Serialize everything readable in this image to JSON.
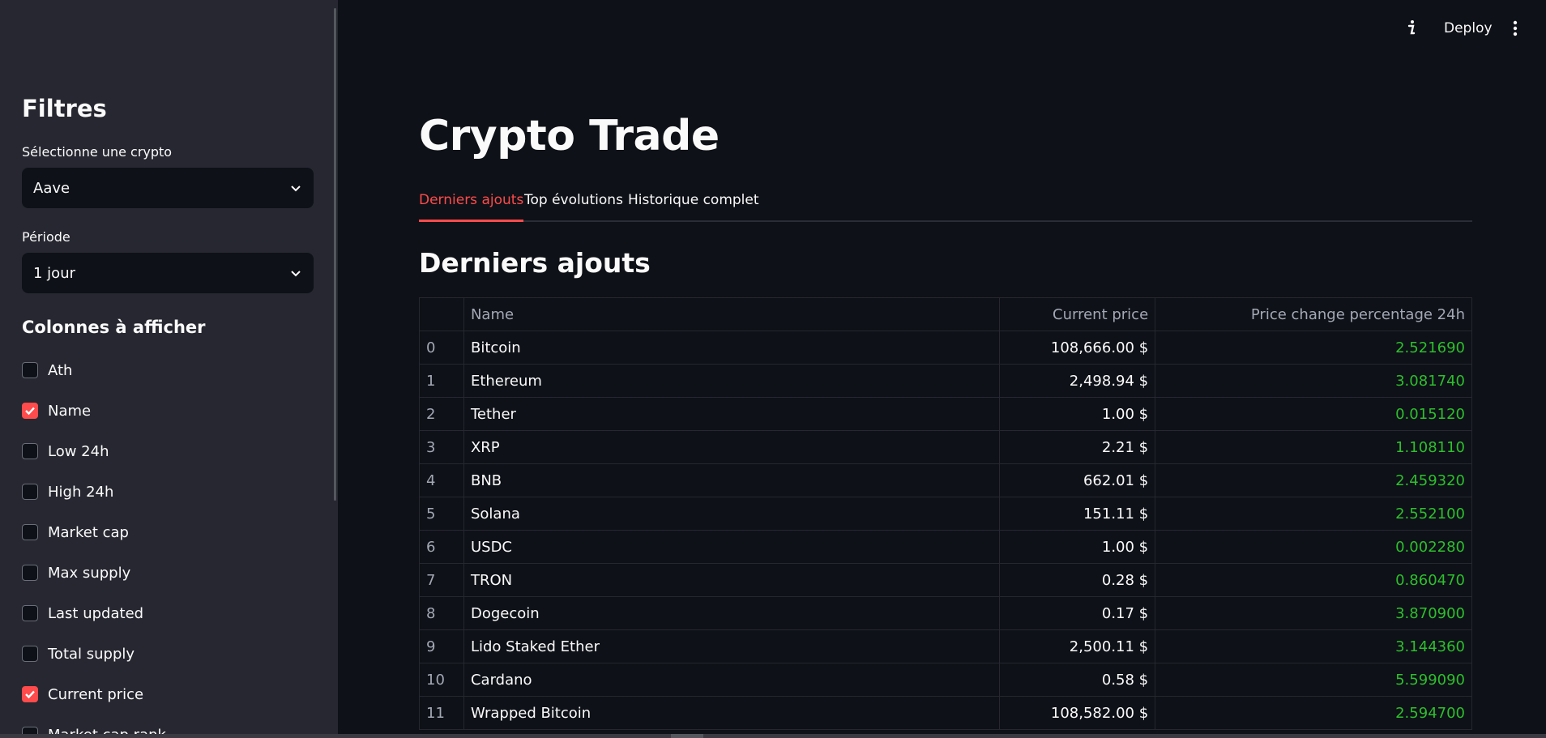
{
  "header": {
    "deploy_label": "Deploy"
  },
  "sidebar": {
    "title": "Filtres",
    "crypto_select": {
      "label": "Sélectionne une crypto",
      "value": "Aave"
    },
    "period_select": {
      "label": "Période",
      "value": "1 jour"
    },
    "columns_title": "Colonnes à afficher",
    "columns": [
      {
        "label": "Ath",
        "checked": false
      },
      {
        "label": "Name",
        "checked": true
      },
      {
        "label": "Low 24h",
        "checked": false
      },
      {
        "label": "High 24h",
        "checked": false
      },
      {
        "label": "Market cap",
        "checked": false
      },
      {
        "label": "Max supply",
        "checked": false
      },
      {
        "label": "Last updated",
        "checked": false
      },
      {
        "label": "Total supply",
        "checked": false
      },
      {
        "label": "Current price",
        "checked": true
      },
      {
        "label": "Market cap rank",
        "checked": false
      }
    ]
  },
  "main": {
    "title": "Crypto Trade",
    "tabs": [
      {
        "label": "Derniers ajouts",
        "active": true
      },
      {
        "label": "Top évolutions",
        "active": false
      },
      {
        "label": "Historique complet",
        "active": false
      }
    ],
    "section_title": "Derniers ajouts",
    "table": {
      "columns": [
        "",
        "Name",
        "Current price",
        "Price change percentage 24h"
      ],
      "rows": [
        [
          "0",
          "Bitcoin",
          "108,666.00 $",
          "2.521690"
        ],
        [
          "1",
          "Ethereum",
          "2,498.94 $",
          "3.081740"
        ],
        [
          "2",
          "Tether",
          "1.00 $",
          "0.015120"
        ],
        [
          "3",
          "XRP",
          "2.21 $",
          "1.108110"
        ],
        [
          "4",
          "BNB",
          "662.01 $",
          "2.459320"
        ],
        [
          "5",
          "Solana",
          "151.11 $",
          "2.552100"
        ],
        [
          "6",
          "USDC",
          "1.00 $",
          "0.002280"
        ],
        [
          "7",
          "TRON",
          "0.28 $",
          "0.860470"
        ],
        [
          "8",
          "Dogecoin",
          "0.17 $",
          "3.870900"
        ],
        [
          "9",
          "Lido Staked Ether",
          "2,500.11 $",
          "3.144360"
        ],
        [
          "10",
          "Cardano",
          "0.58 $",
          "5.599090"
        ],
        [
          "11",
          "Wrapped Bitcoin",
          "108,582.00 $",
          "2.594700"
        ]
      ]
    }
  },
  "colors": {
    "accent": "#ff4b4b",
    "positive": "#2dbf2d",
    "sidebar_bg": "#262730",
    "main_bg": "#0e1117"
  }
}
